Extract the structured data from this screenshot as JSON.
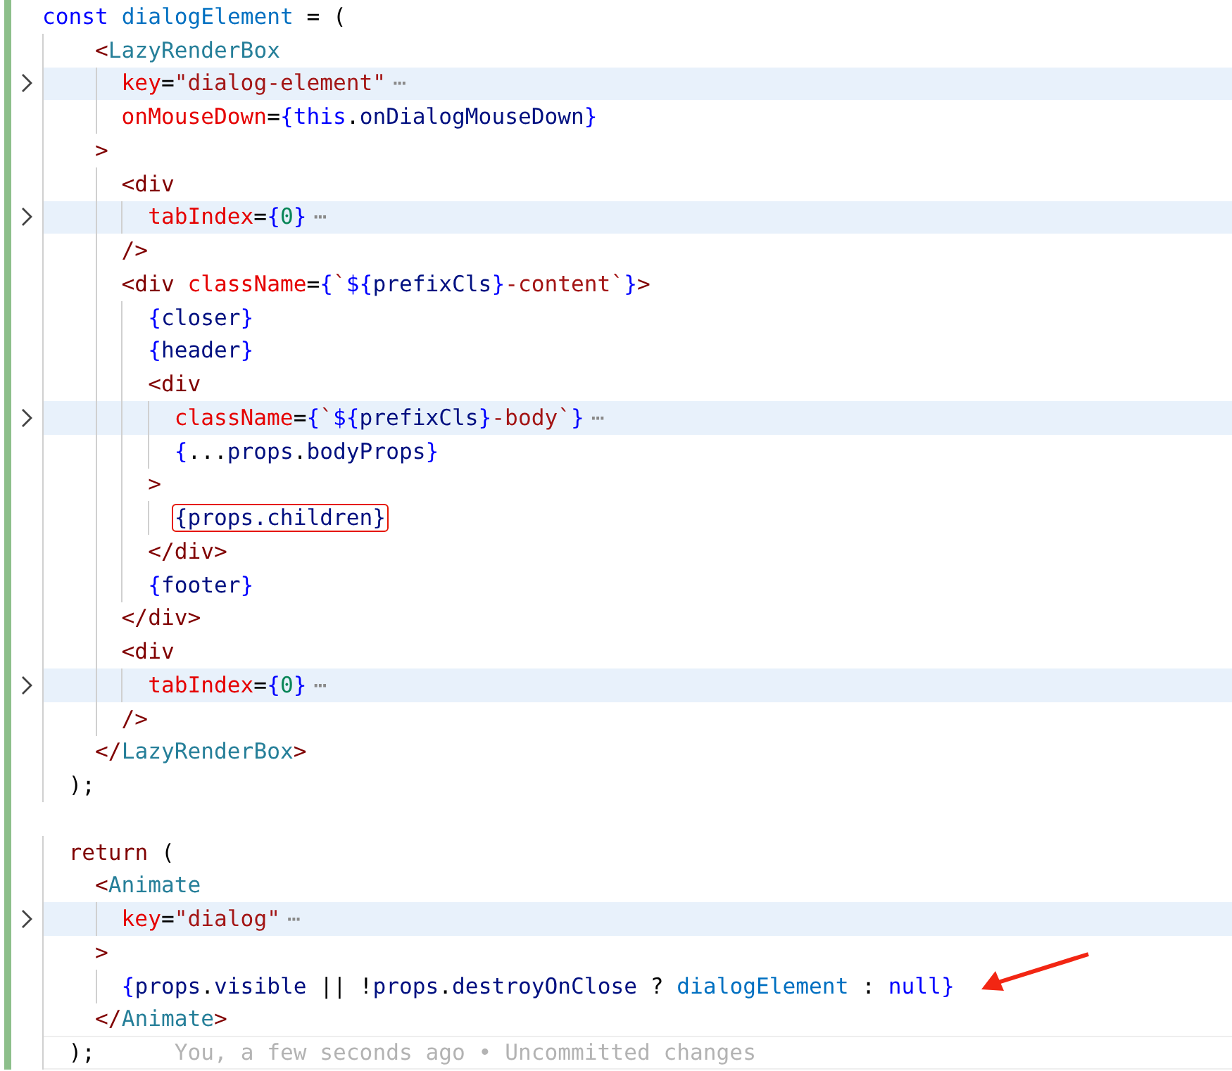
{
  "editor": {
    "lines": [
      {
        "changed": true,
        "tokens": [
          {
            "text": "const",
            "kind": "keyword"
          },
          {
            "text": " dialogElement",
            "kind": "variable"
          },
          {
            "text": " = (",
            "kind": "plain"
          }
        ]
      },
      {
        "changed": true,
        "tokens": [
          {
            "text": "    <",
            "kind": "tag"
          },
          {
            "text": "LazyRenderBox",
            "kind": "component"
          }
        ]
      },
      {
        "changed": true,
        "folded": true,
        "fold_marker": "⋯",
        "tokens": [
          {
            "text": "      key",
            "kind": "attribute"
          },
          {
            "text": "=",
            "kind": "plain"
          },
          {
            "text": "\"dialog-element\"",
            "kind": "string"
          }
        ]
      },
      {
        "changed": true,
        "tokens": [
          {
            "text": "      onMouseDown",
            "kind": "attribute"
          },
          {
            "text": "=",
            "kind": "plain"
          },
          {
            "text": "{",
            "kind": "brace"
          },
          {
            "text": "this",
            "kind": "keyword"
          },
          {
            "text": ".",
            "kind": "plain"
          },
          {
            "text": "onDialogMouseDown",
            "kind": "property"
          },
          {
            "text": "}",
            "kind": "brace"
          }
        ]
      },
      {
        "changed": true,
        "tokens": [
          {
            "text": "    >",
            "kind": "tag"
          }
        ]
      },
      {
        "changed": true,
        "tokens": [
          {
            "text": "      <div",
            "kind": "tag"
          }
        ]
      },
      {
        "changed": true,
        "folded": true,
        "fold_marker": "⋯",
        "tokens": [
          {
            "text": "        tabIndex",
            "kind": "attribute"
          },
          {
            "text": "=",
            "kind": "plain"
          },
          {
            "text": "{",
            "kind": "brace"
          },
          {
            "text": "0",
            "kind": "number"
          },
          {
            "text": "}",
            "kind": "brace"
          }
        ]
      },
      {
        "changed": true,
        "tokens": [
          {
            "text": "      />",
            "kind": "tag"
          }
        ]
      },
      {
        "changed": true,
        "tokens": [
          {
            "text": "      <div ",
            "kind": "tag"
          },
          {
            "text": "className",
            "kind": "attribute"
          },
          {
            "text": "=",
            "kind": "plain"
          },
          {
            "text": "{",
            "kind": "brace"
          },
          {
            "text": "`",
            "kind": "string"
          },
          {
            "text": "${",
            "kind": "brace"
          },
          {
            "text": "prefixCls",
            "kind": "property"
          },
          {
            "text": "}",
            "kind": "brace"
          },
          {
            "text": "-content`",
            "kind": "string"
          },
          {
            "text": "}",
            "kind": "brace"
          },
          {
            "text": ">",
            "kind": "tag"
          }
        ]
      },
      {
        "changed": true,
        "tokens": [
          {
            "text": "        {",
            "kind": "brace"
          },
          {
            "text": "closer",
            "kind": "property"
          },
          {
            "text": "}",
            "kind": "brace"
          }
        ]
      },
      {
        "changed": true,
        "tokens": [
          {
            "text": "        {",
            "kind": "brace"
          },
          {
            "text": "header",
            "kind": "property"
          },
          {
            "text": "}",
            "kind": "brace"
          }
        ]
      },
      {
        "changed": true,
        "tokens": [
          {
            "text": "        <div",
            "kind": "tag"
          }
        ]
      },
      {
        "changed": true,
        "folded": true,
        "fold_marker": "⋯",
        "tokens": [
          {
            "text": "          className",
            "kind": "attribute"
          },
          {
            "text": "=",
            "kind": "plain"
          },
          {
            "text": "{",
            "kind": "brace"
          },
          {
            "text": "`",
            "kind": "string"
          },
          {
            "text": "${",
            "kind": "brace"
          },
          {
            "text": "prefixCls",
            "kind": "property"
          },
          {
            "text": "}",
            "kind": "brace"
          },
          {
            "text": "-body`",
            "kind": "string"
          },
          {
            "text": "}",
            "kind": "brace"
          }
        ]
      },
      {
        "changed": true,
        "tokens": [
          {
            "text": "          {",
            "kind": "brace"
          },
          {
            "text": "...",
            "kind": "plain"
          },
          {
            "text": "props",
            "kind": "property"
          },
          {
            "text": ".",
            "kind": "plain"
          },
          {
            "text": "bodyProps",
            "kind": "property"
          },
          {
            "text": "}",
            "kind": "brace"
          }
        ]
      },
      {
        "changed": true,
        "tokens": [
          {
            "text": "        >",
            "kind": "tag"
          }
        ]
      },
      {
        "changed": true,
        "tokens": [
          {
            "text": "          {props.children}",
            "kind": "property",
            "boxed": true
          }
        ]
      },
      {
        "changed": true,
        "tokens": [
          {
            "text": "        </div>",
            "kind": "tag"
          }
        ]
      },
      {
        "changed": true,
        "tokens": [
          {
            "text": "        {",
            "kind": "brace"
          },
          {
            "text": "footer",
            "kind": "property"
          },
          {
            "text": "}",
            "kind": "brace"
          }
        ]
      },
      {
        "changed": true,
        "tokens": [
          {
            "text": "      </div>",
            "kind": "tag"
          }
        ]
      },
      {
        "changed": true,
        "tokens": [
          {
            "text": "      <div",
            "kind": "tag"
          }
        ]
      },
      {
        "changed": true,
        "folded": true,
        "fold_marker": "⋯",
        "tokens": [
          {
            "text": "        tabIndex",
            "kind": "attribute"
          },
          {
            "text": "=",
            "kind": "plain"
          },
          {
            "text": "{",
            "kind": "brace"
          },
          {
            "text": "0",
            "kind": "number"
          },
          {
            "text": "}",
            "kind": "brace"
          }
        ]
      },
      {
        "changed": true,
        "tokens": [
          {
            "text": "      />",
            "kind": "tag"
          }
        ]
      },
      {
        "changed": true,
        "tokens": [
          {
            "text": "    </",
            "kind": "tag"
          },
          {
            "text": "LazyRenderBox",
            "kind": "component"
          },
          {
            "text": ">",
            "kind": "tag"
          }
        ]
      },
      {
        "changed": true,
        "tokens": [
          {
            "text": "  );",
            "kind": "plain"
          }
        ]
      },
      {
        "changed": true
      },
      {
        "changed": true,
        "tokens": [
          {
            "text": "  return",
            "kind": "control"
          },
          {
            "text": " (",
            "kind": "plain"
          }
        ]
      },
      {
        "changed": true,
        "tokens": [
          {
            "text": "    <",
            "kind": "tag"
          },
          {
            "text": "Animate",
            "kind": "component"
          }
        ]
      },
      {
        "changed": true,
        "folded": true,
        "fold_marker": "⋯",
        "tokens": [
          {
            "text": "      key",
            "kind": "attribute"
          },
          {
            "text": "=",
            "kind": "plain"
          },
          {
            "text": "\"dialog\"",
            "kind": "string"
          }
        ]
      },
      {
        "changed": true,
        "tokens": [
          {
            "text": "    >",
            "kind": "tag"
          }
        ]
      },
      {
        "changed": true,
        "pointer_arrow": true,
        "tokens": [
          {
            "text": "      {",
            "kind": "brace"
          },
          {
            "text": "props",
            "kind": "property"
          },
          {
            "text": ".",
            "kind": "plain"
          },
          {
            "text": "visible",
            "kind": "property"
          },
          {
            "text": " || !",
            "kind": "plain"
          },
          {
            "text": "props",
            "kind": "property"
          },
          {
            "text": ".",
            "kind": "plain"
          },
          {
            "text": "destroyOnClose",
            "kind": "property"
          },
          {
            "text": " ? ",
            "kind": "plain"
          },
          {
            "text": "dialogElement",
            "kind": "variable"
          },
          {
            "text": " : ",
            "kind": "plain"
          },
          {
            "text": "null",
            "kind": "keyword"
          },
          {
            "text": "}",
            "kind": "brace"
          }
        ]
      },
      {
        "changed": true,
        "tokens": [
          {
            "text": "    </",
            "kind": "tag"
          },
          {
            "text": "Animate",
            "kind": "component"
          },
          {
            "text": ">",
            "kind": "tag"
          }
        ]
      },
      {
        "changed": true,
        "current": true,
        "blame": "You, a few seconds ago • Uncommitted changes",
        "tokens": [
          {
            "text": "  );",
            "kind": "plain"
          }
        ]
      }
    ]
  }
}
